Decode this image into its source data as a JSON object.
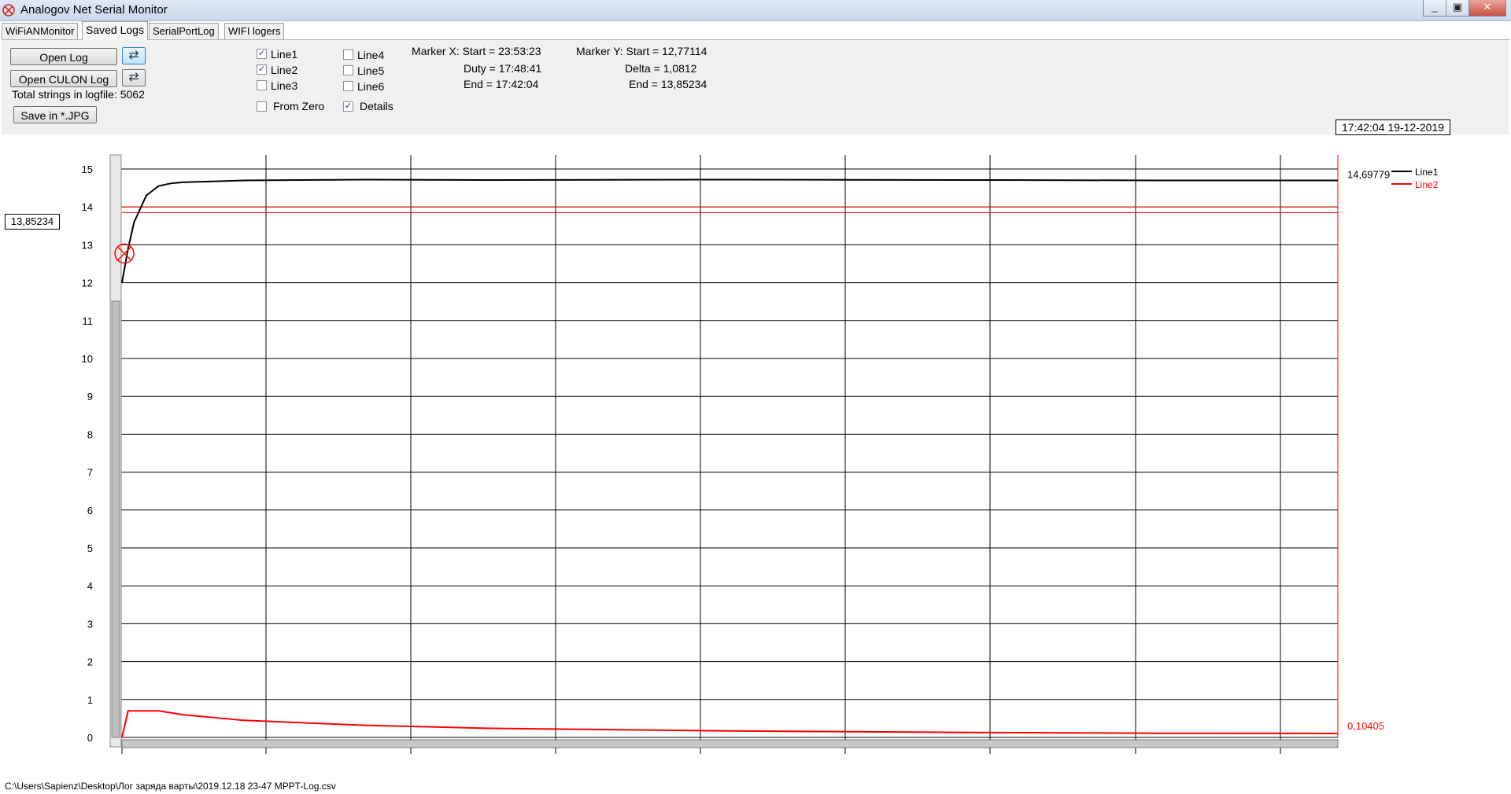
{
  "window": {
    "title": "Analogov Net Serial Monitor",
    "buttons": [
      "minimize-icon",
      "maximize-icon",
      "close-icon"
    ]
  },
  "tabs": [
    {
      "label": "WiFiANMonitor",
      "active": false
    },
    {
      "label": "Saved Logs",
      "active": true
    },
    {
      "label": "SerialPortLog",
      "active": false
    },
    {
      "label": "WIFI logers",
      "active": false
    }
  ],
  "toolbar": {
    "open_log": "Open Log",
    "open_culon_log": "Open CULON Log",
    "refresh_icon": "refresh-icon",
    "total_strings": "Total strings in logfile: 5062",
    "save_jpg": "Save in *.JPG"
  },
  "lines": [
    {
      "label": "Line1",
      "checked": true
    },
    {
      "label": "Line2",
      "checked": true
    },
    {
      "label": "Line3",
      "checked": false
    },
    {
      "label": "Line4",
      "checked": false
    },
    {
      "label": "Line5",
      "checked": false
    },
    {
      "label": "Line6",
      "checked": false
    }
  ],
  "options": {
    "from_zero": {
      "label": "From Zero",
      "checked": false
    },
    "details": {
      "label": "Details",
      "checked": true
    }
  },
  "marker_x": {
    "start": "Marker X: Start = 23:53:23",
    "duty": "Duty = 17:48:41",
    "end": "End  = 17:42:04"
  },
  "marker_y": {
    "start": "Marker Y: Start = 12,77114",
    "delta": "Delta = 1,0812",
    "end": "End  = 13,85234"
  },
  "timestamp": "17:42:04 19-12-2019",
  "cursor_value": "13,85234",
  "status": {
    "path": "C:\\Users\\Sapienz\\Desktop\\Лог заряда варты\\2019.12.18 23-47 MPPT-Log.csv"
  },
  "chart_data": {
    "type": "line",
    "ylim": [
      0,
      15
    ],
    "yticks": [
      0,
      1,
      2,
      3,
      4,
      5,
      6,
      7,
      8,
      9,
      10,
      11,
      12,
      13,
      14,
      15
    ],
    "x": [
      0,
      0.005,
      0.01,
      0.02,
      0.03,
      0.04,
      0.05,
      0.1,
      0.2,
      0.3,
      0.5,
      0.7,
      0.85,
      1.0
    ],
    "series": [
      {
        "name": "Line1",
        "color": "#000000",
        "end_label": "14,69779",
        "values": [
          12.0,
          12.9,
          13.6,
          14.3,
          14.55,
          14.62,
          14.65,
          14.7,
          14.72,
          14.71,
          14.72,
          14.71,
          14.7,
          14.7
        ]
      },
      {
        "name": "Line2",
        "color": "#ff0000",
        "end_label": "0,10405",
        "values": [
          0.0,
          0.7,
          0.7,
          0.7,
          0.7,
          0.65,
          0.6,
          0.45,
          0.32,
          0.24,
          0.17,
          0.13,
          0.11,
          0.104
        ]
      }
    ],
    "marker_y_lines": [
      14.0,
      13.85
    ],
    "marker_x_start": 0.002,
    "legend": "top-right",
    "grid": true
  }
}
